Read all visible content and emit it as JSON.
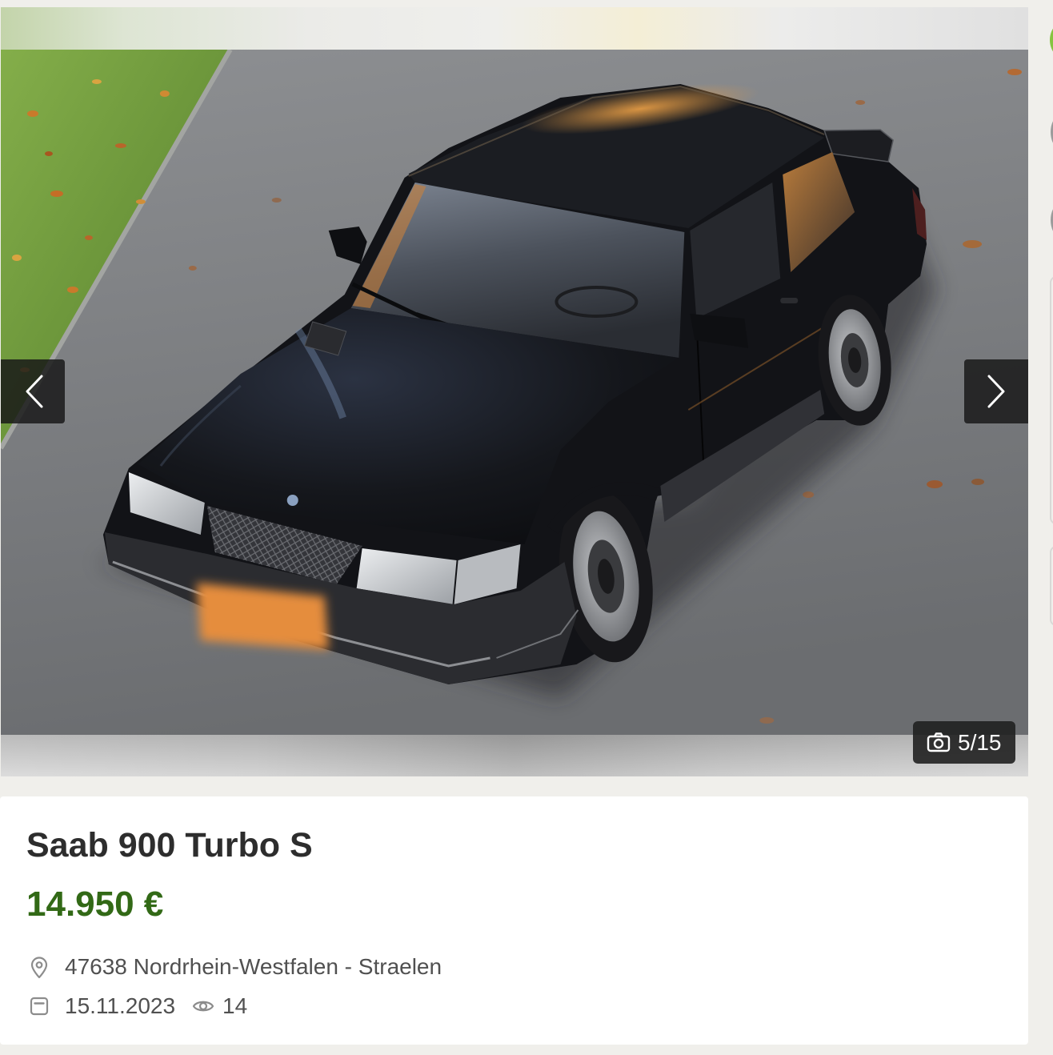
{
  "gallery": {
    "counter": "5/15",
    "icons": {
      "previous": "chevron-left-icon",
      "next": "chevron-right-icon",
      "counter": "camera-icon"
    }
  },
  "listing": {
    "title": "Saab 900 Turbo S",
    "price": "14.950 €",
    "location": "47638 Nordrhein-Westfalen - Straelen",
    "posted_date": "15.11.2023",
    "view_count": "14",
    "icons": {
      "location": "location-pin-icon",
      "date": "calendar-icon",
      "views": "eye-icon"
    }
  },
  "colors": {
    "page_background": "#f0efeb",
    "card_background": "#ffffff",
    "title": "#2d2d2d",
    "price": "#326916",
    "meta_text": "#505050",
    "icon": "#8c8c8c",
    "overlay": "#181818",
    "sidebar_accent": "#86c440"
  }
}
